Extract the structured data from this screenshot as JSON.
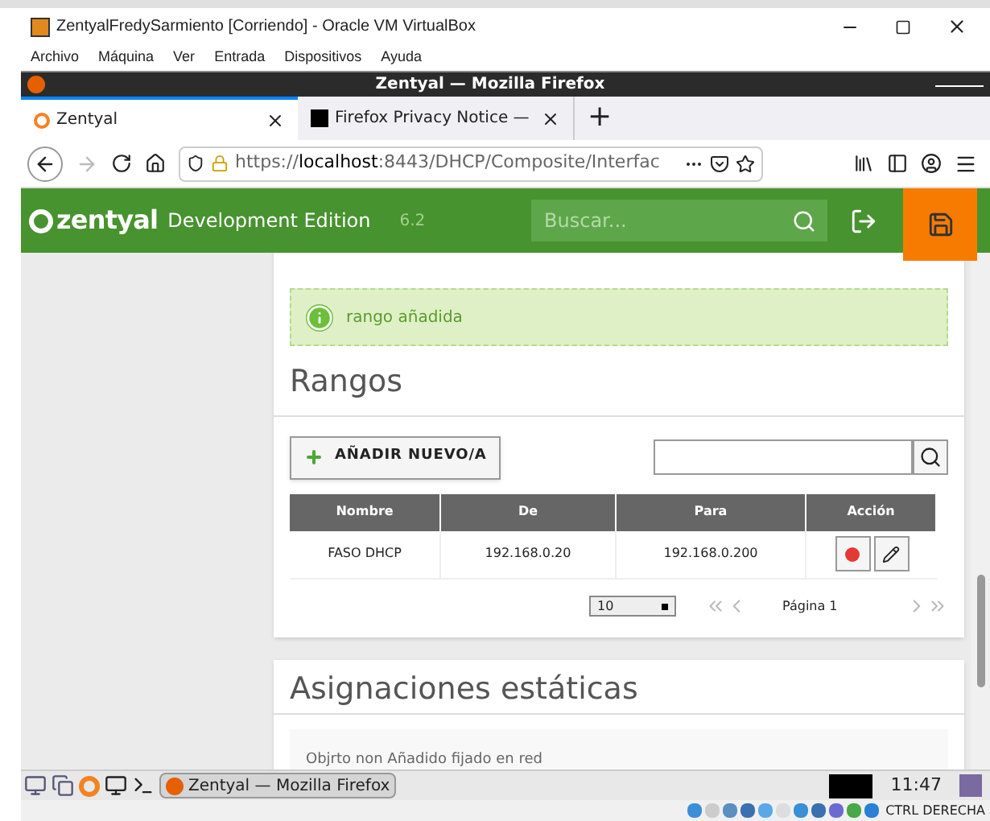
{
  "vm_window": {
    "title": "ZentyalFredySarmiento [Corriendo] - Oracle VM VirtualBox",
    "menu": [
      "Archivo",
      "Máquina",
      "Ver",
      "Entrada",
      "Dispositivos",
      "Ayuda"
    ]
  },
  "browser": {
    "title": "Zentyal — Mozilla Firefox",
    "tabs": [
      {
        "label": "Zentyal",
        "selected": true
      },
      {
        "label": "Firefox Privacy Notice —",
        "selected": false
      }
    ],
    "new_tab": "+",
    "url": {
      "scheme": "https://",
      "host": "localhost",
      "rest": ":8443/DHCP/Composite/Interfac"
    },
    "forward_disabled": true
  },
  "header": {
    "brand": "zentyal",
    "edition": "Development Edition",
    "version": "6.2",
    "search": {
      "placeholder": "Buscar..."
    }
  },
  "notice": {
    "text": "rango añadida"
  },
  "ranges": {
    "title": "Rangos",
    "add_button": "AÑADIR NUEVO/A",
    "columns": [
      "Nombre",
      "De",
      "Para",
      "Acción"
    ],
    "rows": [
      {
        "name": "FASO DHCP",
        "from": "192.168.0.20",
        "to": "192.168.0.200"
      }
    ],
    "page_size": "10",
    "page": "Página 1"
  },
  "static": {
    "title": "Asignaciones estáticas",
    "message": "Objrto non Añadido fijado en red"
  },
  "taskbar": {
    "task": "Zentyal — Mozilla Firefox",
    "clock": "11:47"
  },
  "status_bar": {
    "host_key": "CTRL DERECHA"
  }
}
